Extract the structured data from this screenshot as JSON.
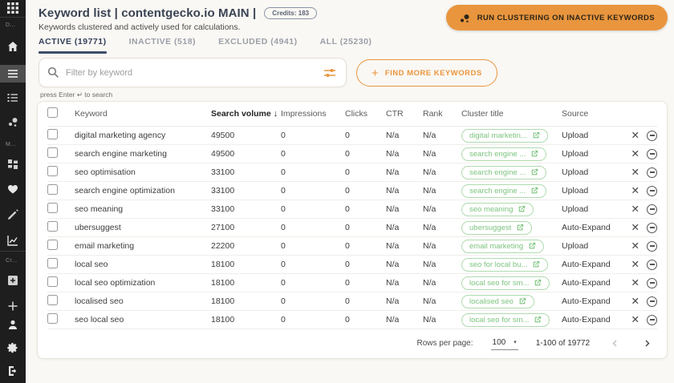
{
  "header": {
    "title": "Keyword list | contentgecko.io MAIN |",
    "credits_badge": "Credits: 183",
    "subtitle": "Keywords clustered and actively used for calculations.",
    "run_clustering_label": "RUN CLUSTERING ON INACTIVE KEYWORDS"
  },
  "sidebar": {
    "section_labels": [
      "D...",
      "M...",
      "Cr..."
    ],
    "icons": [
      "apps-grid",
      "home",
      "keyword-list",
      "ordered-list",
      "cluster-dots",
      "dashboard-grid",
      "heart",
      "pencil",
      "analytics-chart",
      "add-box",
      "plus",
      "account",
      "settings",
      "logout"
    ]
  },
  "tabs": [
    {
      "label": "ACTIVE (19771)",
      "active": true
    },
    {
      "label": "INACTIVE (518)",
      "active": false
    },
    {
      "label": "EXCLUDED (4941)",
      "active": false
    },
    {
      "label": "ALL (25230)",
      "active": false
    }
  ],
  "search": {
    "placeholder": "Filter by keyword",
    "hint": "press Enter ↵ to search",
    "find_more_label": "FIND MORE KEYWORDS",
    "find_more_plus": "+"
  },
  "table": {
    "columns": [
      "Keyword",
      "Search volume",
      "Impressions",
      "Clicks",
      "CTR",
      "Rank",
      "Cluster title",
      "Source"
    ],
    "sort_column": "Search volume",
    "sort_direction": "desc",
    "sort_arrow": "↓",
    "rows": [
      {
        "keyword": "digital marketing agency",
        "search_volume": "49500",
        "impressions": "0",
        "clicks": "0",
        "ctr": "N/a",
        "rank": "N/a",
        "cluster": "digital marketin...",
        "source": "Upload"
      },
      {
        "keyword": "search engine marketing",
        "search_volume": "49500",
        "impressions": "0",
        "clicks": "0",
        "ctr": "N/a",
        "rank": "N/a",
        "cluster": "search engine ...",
        "source": "Upload"
      },
      {
        "keyword": "seo optimisation",
        "search_volume": "33100",
        "impressions": "0",
        "clicks": "0",
        "ctr": "N/a",
        "rank": "N/a",
        "cluster": "search engine ...",
        "source": "Upload"
      },
      {
        "keyword": "search engine optimization",
        "search_volume": "33100",
        "impressions": "0",
        "clicks": "0",
        "ctr": "N/a",
        "rank": "N/a",
        "cluster": "search engine ...",
        "source": "Upload"
      },
      {
        "keyword": "seo meaning",
        "search_volume": "33100",
        "impressions": "0",
        "clicks": "0",
        "ctr": "N/a",
        "rank": "N/a",
        "cluster": "seo meaning",
        "source": "Upload"
      },
      {
        "keyword": "ubersuggest",
        "search_volume": "27100",
        "impressions": "0",
        "clicks": "0",
        "ctr": "N/a",
        "rank": "N/a",
        "cluster": "ubersuggest",
        "source": "Auto-Expand"
      },
      {
        "keyword": "email marketing",
        "search_volume": "22200",
        "impressions": "0",
        "clicks": "0",
        "ctr": "N/a",
        "rank": "N/a",
        "cluster": "email marketing",
        "source": "Upload"
      },
      {
        "keyword": "local seo",
        "search_volume": "18100",
        "impressions": "0",
        "clicks": "0",
        "ctr": "N/a",
        "rank": "N/a",
        "cluster": "seo for local bu...",
        "source": "Auto-Expand"
      },
      {
        "keyword": "local seo optimization",
        "search_volume": "18100",
        "impressions": "0",
        "clicks": "0",
        "ctr": "N/a",
        "rank": "N/a",
        "cluster": "local seo for sm...",
        "source": "Auto-Expand"
      },
      {
        "keyword": "localised seo",
        "search_volume": "18100",
        "impressions": "0",
        "clicks": "0",
        "ctr": "N/a",
        "rank": "N/a",
        "cluster": "localised seo",
        "source": "Auto-Expand"
      },
      {
        "keyword": "seo local seo",
        "search_volume": "18100",
        "impressions": "0",
        "clicks": "0",
        "ctr": "N/a",
        "rank": "N/a",
        "cluster": "local seo for sm...",
        "source": "Auto-Expand"
      }
    ]
  },
  "pagination": {
    "rows_per_page_label": "Rows per page:",
    "rows_per_page_value": "100",
    "caret": "▾",
    "range_label": "1-100 of 19772"
  },
  "colors": {
    "accent_orange": "#E9953D",
    "cluster_green": "#7CC47F",
    "cluster_green_border": "#AFDAAF",
    "sidebar_bg": "#1E1E1E",
    "page_bg": "#FAF8F4",
    "tab_active": "#33405B"
  }
}
